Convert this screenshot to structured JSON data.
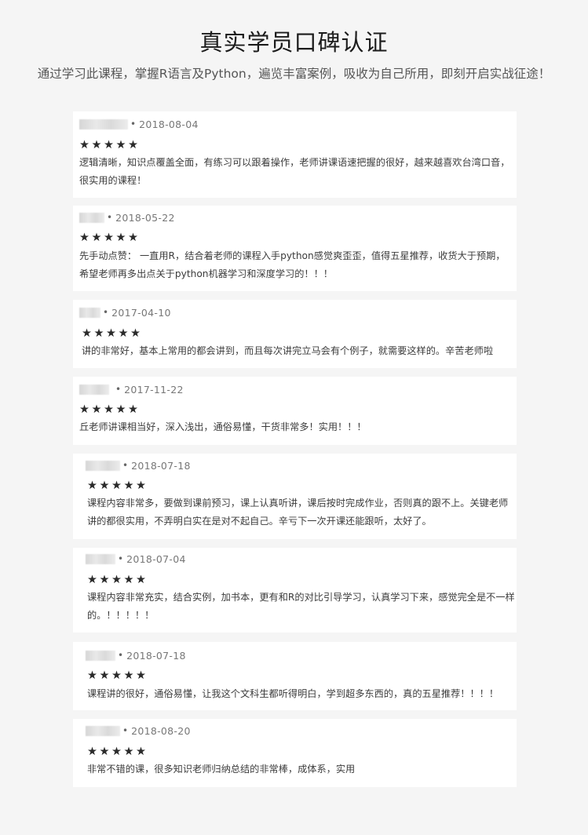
{
  "header": {
    "title": "真实学员口碑认证",
    "subtitle": "通过学习此课程，掌握R语言及Python，遍览丰富案例，吸收为自己所用，即刻开启实战征途！"
  },
  "reviews": [
    {
      "date": "2018-08-04",
      "stars": "★★★★★",
      "text": "逻辑清晰，知识点覆盖全面，有练习可以跟着操作，老师讲课语速把握的很好，越来越喜欢台湾口音，很实用的课程！"
    },
    {
      "date": "2018-05-22",
      "stars": "★★★★★",
      "text": "先手动点赞： 一直用R，结合着老师的课程入手python感觉爽歪歪，值得五星推荐，收货大于预期，希望老师再多出点关于python机器学习和深度学习的！！！"
    },
    {
      "date": "2017-04-10",
      "stars": "★★★★★",
      "text": "讲的非常好，基本上常用的都会讲到，而且每次讲完立马会有个例子，就需要这样的。辛苦老师啦"
    },
    {
      "date": "2017-11-22",
      "stars": "★★★★★",
      "text": "丘老师讲课相当好，深入浅出，通俗易懂，干货非常多！实用！！！"
    },
    {
      "date": "2018-07-18",
      "stars": "★★★★★",
      "text": "课程内容非常多，要做到课前预习，课上认真听讲，课后按时完成作业，否则真的跟不上。关键老师讲的都很实用，不弄明白实在是对不起自己。辛亏下一次开课还能跟听，太好了。"
    },
    {
      "date": "2018-07-04",
      "stars": "★★★★★",
      "text": "课程内容非常充实，结合实例，加书本，更有和R的对比引导学习，认真学习下来，感觉完全是不一样的。！！！！！"
    },
    {
      "date": "2018-07-18",
      "stars": "★★★★★",
      "text": "课程讲的很好，通俗易懂，让我这个文科生都听得明白，学到超多东西的，真的五星推荐！！！！"
    },
    {
      "date": "2018-08-20",
      "stars": "★★★★★",
      "text": "非常不错的课，很多知识老师归纳总结的非常棒，成体系，实用"
    }
  ]
}
